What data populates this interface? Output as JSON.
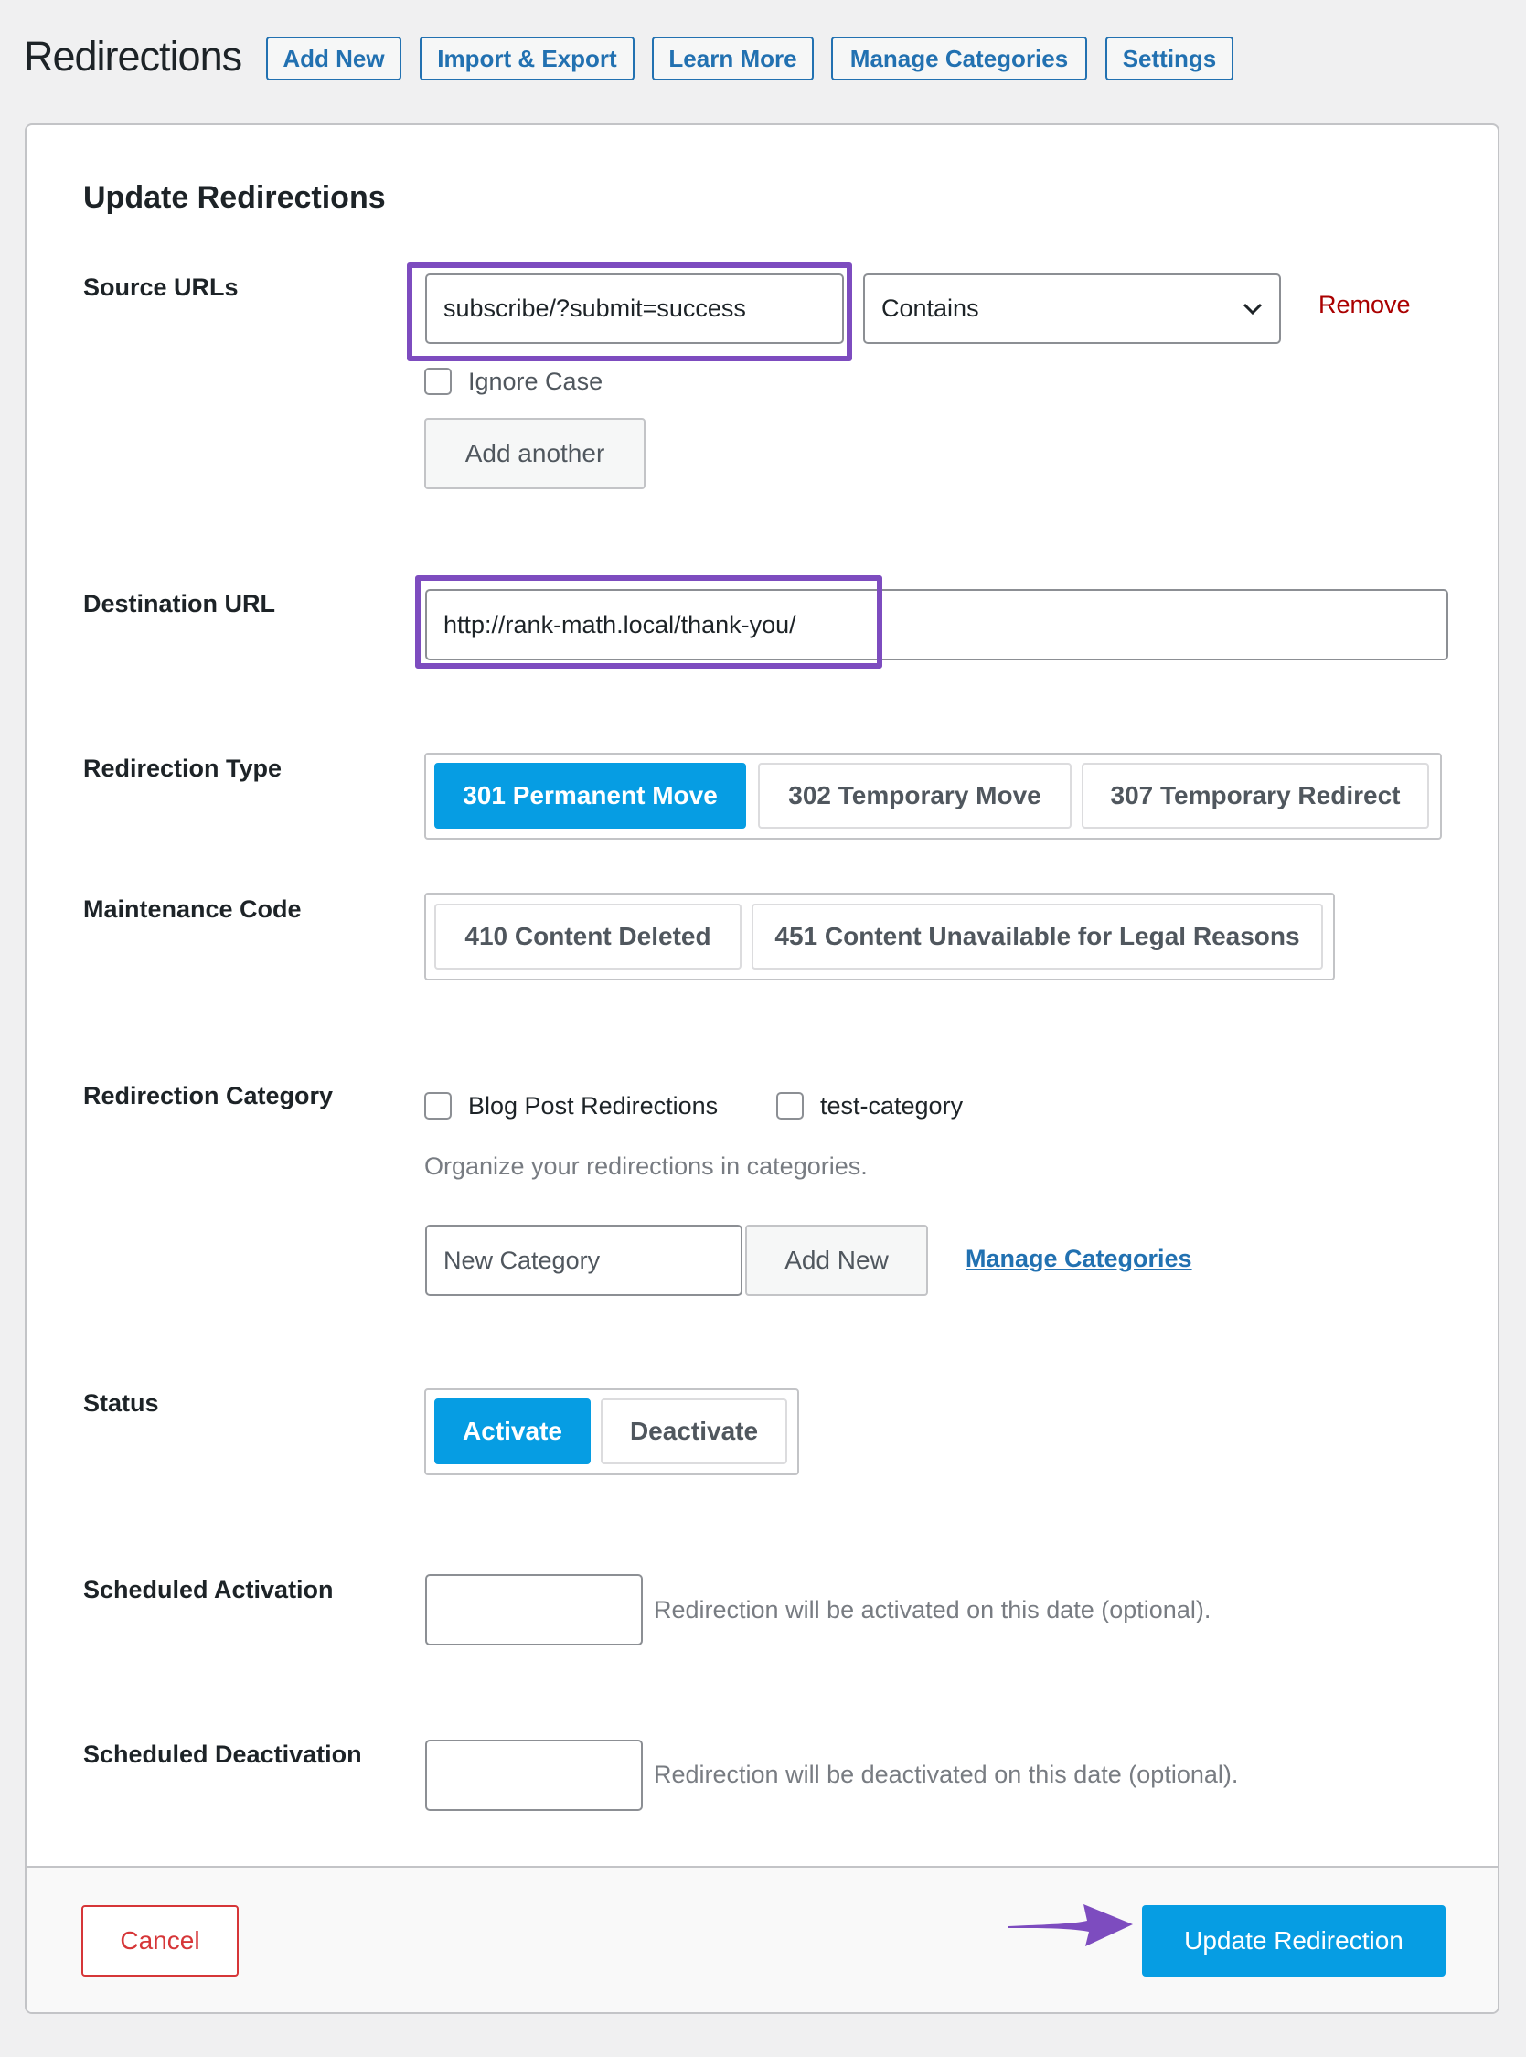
{
  "header": {
    "title": "Redirections",
    "buttons": [
      "Add New",
      "Import & Export",
      "Learn More",
      "Manage Categories",
      "Settings"
    ]
  },
  "form": {
    "heading": "Update Redirections",
    "source": {
      "label": "Source URLs",
      "value": "subscribe/?submit=success",
      "match": "Contains",
      "remove": "Remove",
      "ignore_case": "Ignore Case",
      "add_another": "Add another"
    },
    "destination": {
      "label": "Destination URL",
      "value": "http://rank-math.local/thank-you/"
    },
    "type": {
      "label": "Redirection Type",
      "options": [
        "301 Permanent Move",
        "302 Temporary Move",
        "307 Temporary Redirect"
      ],
      "selected": "301 Permanent Move"
    },
    "maintenance": {
      "label": "Maintenance Code",
      "options": [
        "410 Content Deleted",
        "451 Content Unavailable for Legal Reasons"
      ]
    },
    "category": {
      "label": "Redirection Category",
      "options": [
        "Blog Post Redirections",
        "test-category"
      ],
      "help": "Organize your redirections in categories.",
      "new_placeholder": "New Category",
      "add_new": "Add New",
      "manage": "Manage Categories"
    },
    "status": {
      "label": "Status",
      "options": [
        "Activate",
        "Deactivate"
      ],
      "selected": "Activate"
    },
    "sched_act": {
      "label": "Scheduled Activation",
      "help": "Redirection will be activated on this date (optional)."
    },
    "sched_deact": {
      "label": "Scheduled Deactivation",
      "help": "Redirection will be deactivated on this date (optional)."
    }
  },
  "footer": {
    "cancel": "Cancel",
    "submit": "Update Redirection"
  },
  "colors": {
    "accent": "#069de3",
    "highlight": "#7d4cbf",
    "link": "#2271b1",
    "danger": "#d63638"
  }
}
